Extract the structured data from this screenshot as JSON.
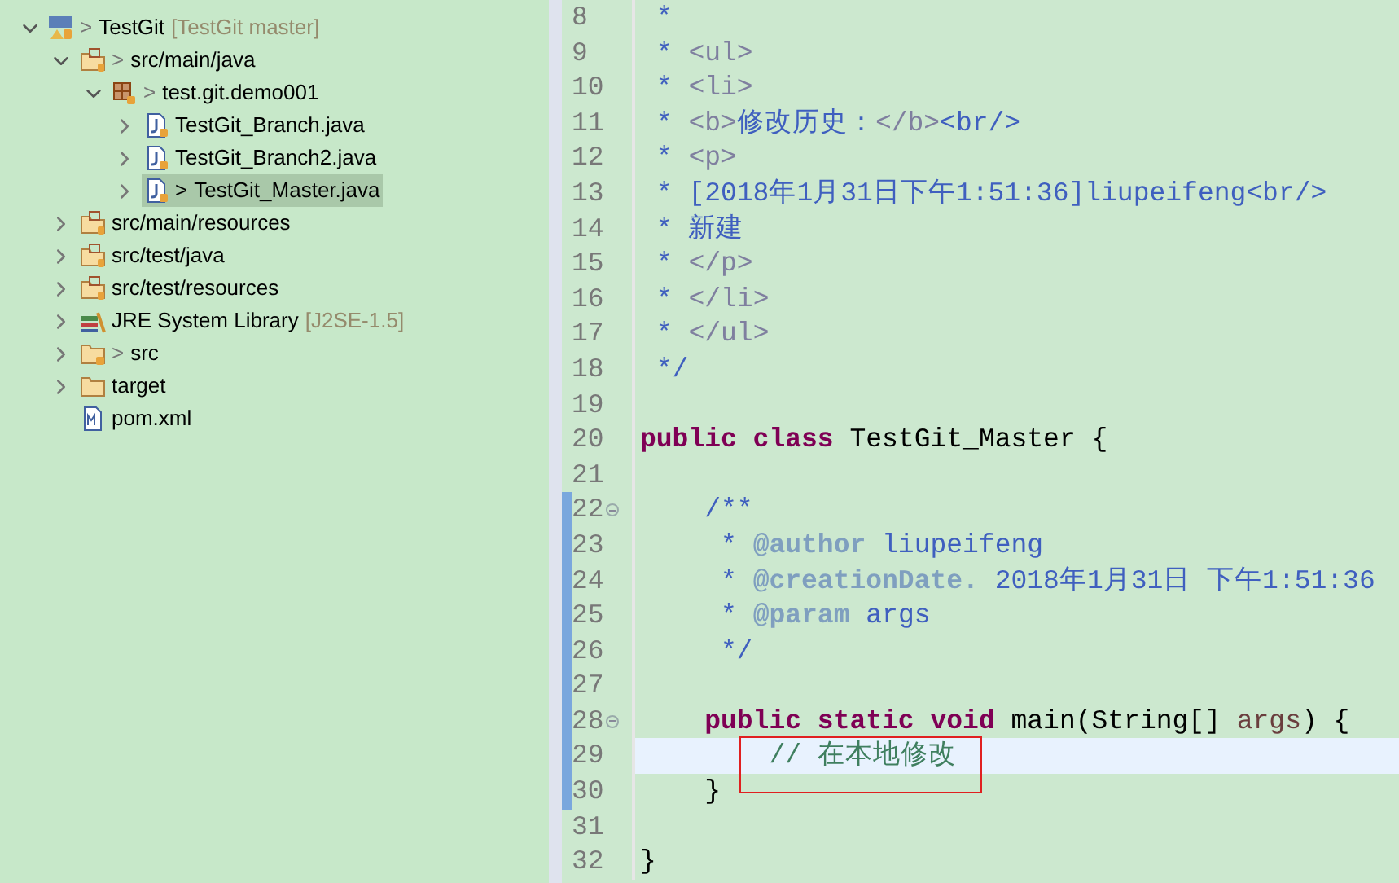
{
  "project_tree": [
    {
      "label": "TestGit",
      "marker": ">",
      "decoration": "[TestGit master]",
      "kind": "project",
      "expanded": true,
      "selected": false,
      "children": [
        {
          "label": "src/main/java",
          "marker": ">",
          "kind": "source-folder",
          "expanded": true,
          "selected": false,
          "children": [
            {
              "label": "test.git.demo001",
              "marker": ">",
              "kind": "package",
              "expanded": true,
              "selected": false,
              "children": [
                {
                  "label": "TestGit_Branch.java",
                  "kind": "java-file",
                  "expanded": false,
                  "selected": false
                },
                {
                  "label": "TestGit_Branch2.java",
                  "kind": "java-file",
                  "expanded": false,
                  "selected": false
                },
                {
                  "label": "TestGit_Master.java",
                  "marker": ">",
                  "kind": "java-file",
                  "expanded": false,
                  "selected": true
                }
              ]
            }
          ]
        },
        {
          "label": "src/main/resources",
          "kind": "source-folder",
          "expanded": false,
          "selected": false
        },
        {
          "label": "src/test/java",
          "kind": "source-folder",
          "expanded": false,
          "selected": false
        },
        {
          "label": "src/test/resources",
          "kind": "source-folder",
          "expanded": false,
          "selected": false
        },
        {
          "label": "JRE System Library",
          "decoration": "[J2SE-1.5]",
          "kind": "library",
          "expanded": false,
          "selected": false
        },
        {
          "label": "src",
          "marker": ">",
          "kind": "folder-tracked",
          "expanded": false,
          "selected": false
        },
        {
          "label": "target",
          "kind": "folder",
          "expanded": false,
          "selected": false
        },
        {
          "label": "pom.xml",
          "kind": "pom-file",
          "selected": false
        }
      ]
    }
  ],
  "editor": {
    "annotation_box": true,
    "lines": [
      {
        "number": "8",
        "changed": false,
        "current": false,
        "fold": false,
        "tokens": [
          {
            "kind": "doc",
            "text": " *"
          }
        ]
      },
      {
        "number": "9",
        "changed": false,
        "current": false,
        "fold": false,
        "tokens": [
          {
            "kind": "doc",
            "text": " * "
          },
          {
            "kind": "doctag",
            "text": "<ul>"
          }
        ]
      },
      {
        "number": "10",
        "changed": false,
        "current": false,
        "fold": false,
        "tokens": [
          {
            "kind": "doc",
            "text": " * "
          },
          {
            "kind": "doctag",
            "text": "<li>"
          }
        ]
      },
      {
        "number": "11",
        "changed": false,
        "current": false,
        "fold": false,
        "tokens": [
          {
            "kind": "doc",
            "text": " * "
          },
          {
            "kind": "doctag",
            "text": "<b>"
          },
          {
            "kind": "doc",
            "text": "修改历史："
          },
          {
            "kind": "doctag",
            "text": "</b>"
          },
          {
            "kind": "doc",
            "text": "<br/>"
          }
        ]
      },
      {
        "number": "12",
        "changed": false,
        "current": false,
        "fold": false,
        "tokens": [
          {
            "kind": "doc",
            "text": " * "
          },
          {
            "kind": "doctag",
            "text": "<p>"
          }
        ]
      },
      {
        "number": "13",
        "changed": false,
        "current": false,
        "fold": false,
        "tokens": [
          {
            "kind": "doc",
            "text": " * [2018年1月31日下午1:51:36]liupeifeng<br/>"
          }
        ]
      },
      {
        "number": "14",
        "changed": false,
        "current": false,
        "fold": false,
        "tokens": [
          {
            "kind": "doc",
            "text": " * 新建"
          }
        ]
      },
      {
        "number": "15",
        "changed": false,
        "current": false,
        "fold": false,
        "tokens": [
          {
            "kind": "doc",
            "text": " * "
          },
          {
            "kind": "doctag",
            "text": "</p>"
          }
        ]
      },
      {
        "number": "16",
        "changed": false,
        "current": false,
        "fold": false,
        "tokens": [
          {
            "kind": "doc",
            "text": " * "
          },
          {
            "kind": "doctag",
            "text": "</li>"
          }
        ]
      },
      {
        "number": "17",
        "changed": false,
        "current": false,
        "fold": false,
        "tokens": [
          {
            "kind": "doc",
            "text": " * "
          },
          {
            "kind": "doctag",
            "text": "</ul>"
          }
        ]
      },
      {
        "number": "18",
        "changed": false,
        "current": false,
        "fold": false,
        "tokens": [
          {
            "kind": "doc",
            "text": " */"
          }
        ]
      },
      {
        "number": "19",
        "changed": false,
        "current": false,
        "fold": false
      },
      {
        "number": "20",
        "changed": false,
        "current": false,
        "fold": false,
        "tokens": [
          {
            "kind": "keyword",
            "text": "public class"
          },
          {
            "kind": "plain",
            "text": " TestGit_Master {"
          }
        ]
      },
      {
        "number": "21",
        "changed": false,
        "current": false,
        "fold": false
      },
      {
        "number": "22",
        "changed": true,
        "current": false,
        "fold": true,
        "tokens": [
          {
            "kind": "doc",
            "text": "    /**"
          }
        ]
      },
      {
        "number": "23",
        "changed": true,
        "current": false,
        "fold": false,
        "tokens": [
          {
            "kind": "doc",
            "text": "     * "
          },
          {
            "kind": "javadoc",
            "text": "@author"
          },
          {
            "kind": "doc",
            "text": " liupeifeng"
          }
        ]
      },
      {
        "number": "24",
        "changed": true,
        "current": false,
        "fold": false,
        "tokens": [
          {
            "kind": "doc",
            "text": "     * "
          },
          {
            "kind": "javadoc",
            "text": "@creationDate."
          },
          {
            "kind": "doc",
            "text": " 2018年1月31日 下午1:51:36"
          }
        ]
      },
      {
        "number": "25",
        "changed": true,
        "current": false,
        "fold": false,
        "tokens": [
          {
            "kind": "doc",
            "text": "     * "
          },
          {
            "kind": "javadoc",
            "text": "@param"
          },
          {
            "kind": "doc",
            "text": " args"
          }
        ]
      },
      {
        "number": "26",
        "changed": true,
        "current": false,
        "fold": false,
        "tokens": [
          {
            "kind": "doc",
            "text": "     */"
          }
        ]
      },
      {
        "number": "27",
        "changed": true,
        "current": false,
        "fold": false
      },
      {
        "number": "28",
        "changed": true,
        "current": false,
        "fold": true,
        "tokens": [
          {
            "kind": "keyword",
            "text": "    public static void"
          },
          {
            "kind": "plain",
            "text": " main(String[] "
          },
          {
            "kind": "param",
            "text": "args"
          },
          {
            "kind": "plain",
            "text": ") {"
          }
        ]
      },
      {
        "number": "29",
        "changed": true,
        "current": true,
        "fold": false,
        "tokens": [
          {
            "kind": "comment",
            "text": "        // 在本地修改"
          }
        ]
      },
      {
        "number": "30",
        "changed": true,
        "current": false,
        "fold": false,
        "tokens": [
          {
            "kind": "plain",
            "text": "    }"
          }
        ]
      },
      {
        "number": "31",
        "changed": false,
        "current": false,
        "fold": false
      },
      {
        "number": "32",
        "changed": false,
        "current": false,
        "fold": false,
        "tokens": [
          {
            "kind": "plain",
            "text": "}"
          }
        ]
      }
    ]
  }
}
